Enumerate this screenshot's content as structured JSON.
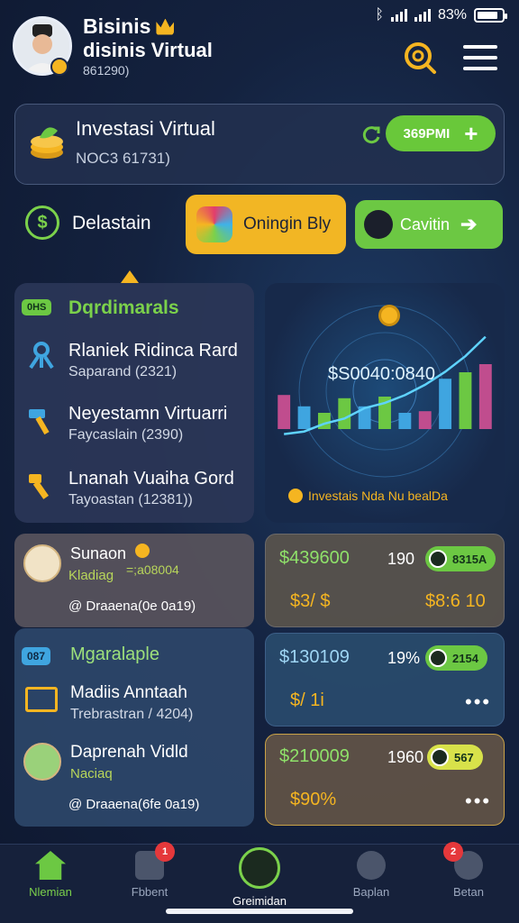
{
  "status": {
    "battery": "83%"
  },
  "header": {
    "title": "Bisinis",
    "subtitle": "disinis Virtual",
    "id": "861290)"
  },
  "invest_card": {
    "title": "Investasi Virtual",
    "code": "NOC3 61731)",
    "button_label": "369PMI"
  },
  "actions": {
    "label": "Delastain",
    "primary_button": "Oningin Bly",
    "secondary_button": "Cavitin"
  },
  "left_panel": {
    "tag": "0HS",
    "title": "Dqrdimarals",
    "items": [
      {
        "title": "Rlaniek Ridinca Rard",
        "subtitle": "Saparand (2321)"
      },
      {
        "title": "Neyestamn Virtuarri",
        "subtitle": "Faycaslain (2390)"
      },
      {
        "title": "Lnanah Vuaiha Gord",
        "subtitle": "Tayoastan (12381))"
      }
    ]
  },
  "chart_panel": {
    "big_value": "$S0040:0840",
    "caption": "Investais Nda Nu bealDa"
  },
  "chart_data": {
    "type": "bar",
    "categories": [
      "",
      "",
      "",
      "",
      "",
      "",
      "",
      "",
      "",
      "",
      ""
    ],
    "values": [
      42,
      28,
      20,
      38,
      28,
      40,
      20,
      22,
      62,
      70,
      80
    ],
    "ylim": [
      0,
      100
    ],
    "colors": [
      "#c04d8e",
      "#3fa5e0",
      "#6cc843",
      "#6cc843",
      "#3fa5e0",
      "#6cc843",
      "#3fa5e0",
      "#c04d8e",
      "#3fa5e0",
      "#6cc843",
      "#c04d8e"
    ],
    "trend_y": [
      10,
      12,
      18,
      22,
      30,
      34,
      40,
      48,
      58,
      70,
      85
    ]
  },
  "user_card_1": {
    "name": "Sunaon",
    "role": "Kladiag",
    "role_value": "=;a08004",
    "footer": "Draaena(0e 0a19)"
  },
  "user_card_2": {
    "tag": "087",
    "title": "Mgaralaple",
    "item": {
      "title": "Madiis Anntaah",
      "subtitle": "Trebrastran / 4204)"
    },
    "person": {
      "name": "Daprenah Vidld",
      "role": "Naciaq"
    },
    "footer": "Draaena(6fe 0a19)"
  },
  "money_cards": [
    {
      "value": "$439600",
      "pct": "190",
      "pill": "8315A",
      "sub": "$3/ $",
      "right": "$8:6 10"
    },
    {
      "value": "$130109",
      "pct": "19%",
      "pill": "2154",
      "sub": "$/ 1i",
      "right": "•••"
    },
    {
      "value": "$210009",
      "pct": "1960",
      "pill": "567",
      "sub": "$90%",
      "right": "•••"
    }
  ],
  "nav": {
    "items": [
      {
        "label": "Nlemian",
        "icon": "home-icon"
      },
      {
        "label": "Fbbent",
        "icon": "news-icon",
        "badge": "1"
      },
      {
        "label": "Greimidan",
        "icon": "center-icon"
      },
      {
        "label": "Baplan",
        "icon": "chat-icon"
      },
      {
        "label": "Betan",
        "icon": "profile-icon",
        "badge": "2"
      }
    ]
  }
}
